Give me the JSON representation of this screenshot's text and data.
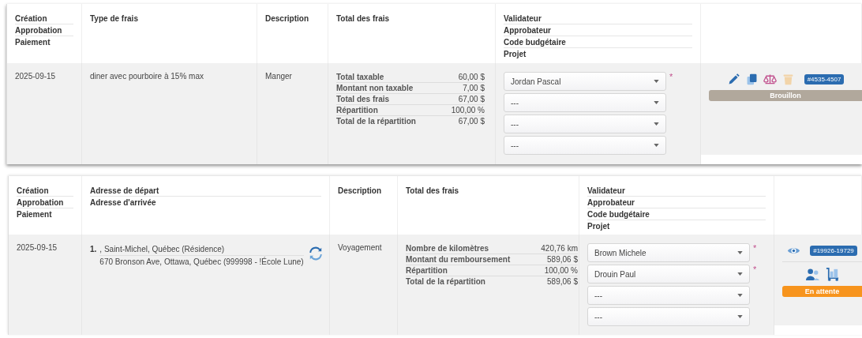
{
  "tables": [
    {
      "kind": "meal",
      "columns": [
        {
          "headers": [
            "Création",
            "Approbation",
            "Paiement"
          ]
        },
        {
          "headers": [
            "Type de frais"
          ]
        },
        {
          "headers": [
            "Description"
          ]
        },
        {
          "headers": [
            "Total des frais"
          ]
        },
        {
          "headers": [
            "Validateur",
            "Approbateur",
            "Code budgétaire",
            "Projet"
          ]
        }
      ],
      "row": {
        "date": "2025-09-15",
        "expense_type": "diner avec pourboire à 15% max",
        "description": "Manger",
        "totals": [
          {
            "label": "Total taxable",
            "value": "60,00 $"
          },
          {
            "label": "Montant non taxable",
            "value": "7,00 $"
          },
          {
            "label": "Total des frais",
            "value": "67,00 $"
          },
          {
            "label": "Répartition",
            "value": "100,00 %"
          },
          {
            "label": "Total de la répartition",
            "value": "67,00 $"
          }
        ],
        "selects": [
          {
            "value": "Jordan Pascal",
            "marker": "*"
          },
          {
            "value": "---"
          },
          {
            "value": "---"
          },
          {
            "value": "---"
          }
        ],
        "actions": [
          {
            "kind": "edit",
            "disabled": false
          },
          {
            "kind": "copy",
            "disabled": false
          },
          {
            "kind": "balance",
            "disabled": false
          },
          {
            "kind": "delete",
            "disabled": true
          }
        ],
        "reference": "#4535-4507",
        "status": {
          "label": "Brouillon",
          "color": "#b1a89c"
        }
      }
    },
    {
      "kind": "mileage",
      "columns": [
        {
          "headers": [
            "Création",
            "Approbation",
            "Paiement"
          ]
        },
        {
          "headers": [
            "Adresse de départ",
            "Adresse d'arrivée"
          ]
        },
        {
          "headers": [
            "Description"
          ]
        },
        {
          "headers": [
            "Total des frais"
          ]
        },
        {
          "headers": [
            "Validateur",
            "Approbateur",
            "Code budgétaire",
            "Projet"
          ]
        }
      ],
      "row": {
        "date": "2025-09-15",
        "route": {
          "number": "1.",
          "start": ", Saint-Michel, Québec (Résidence)",
          "end": "670 Bronson Ave, Ottawa, Québec (999998 - !École Lune)"
        },
        "description": "Voyagement",
        "totals": [
          {
            "label": "Nombre de kilomètres",
            "value": "420,76 km"
          },
          {
            "label": "Montant du remboursement",
            "value": "589,06 $"
          },
          {
            "label": "Répartition",
            "value": "100,00 %"
          },
          {
            "label": "Total de la répartition",
            "value": "589,06 $"
          }
        ],
        "selects": [
          {
            "value": "Brown Michele",
            "marker": "*"
          },
          {
            "value": "Drouin Paul",
            "marker": "*"
          },
          {
            "value": "---"
          },
          {
            "value": "---"
          }
        ],
        "actions": [
          {
            "kind": "view",
            "disabled": false
          }
        ],
        "reference": "#19926-19729",
        "secondary_actions": [
          {
            "kind": "people",
            "disabled": false
          },
          {
            "kind": "cart",
            "disabled": false
          }
        ],
        "status": {
          "label": "En attente",
          "color": "#f7941d"
        }
      }
    }
  ]
}
